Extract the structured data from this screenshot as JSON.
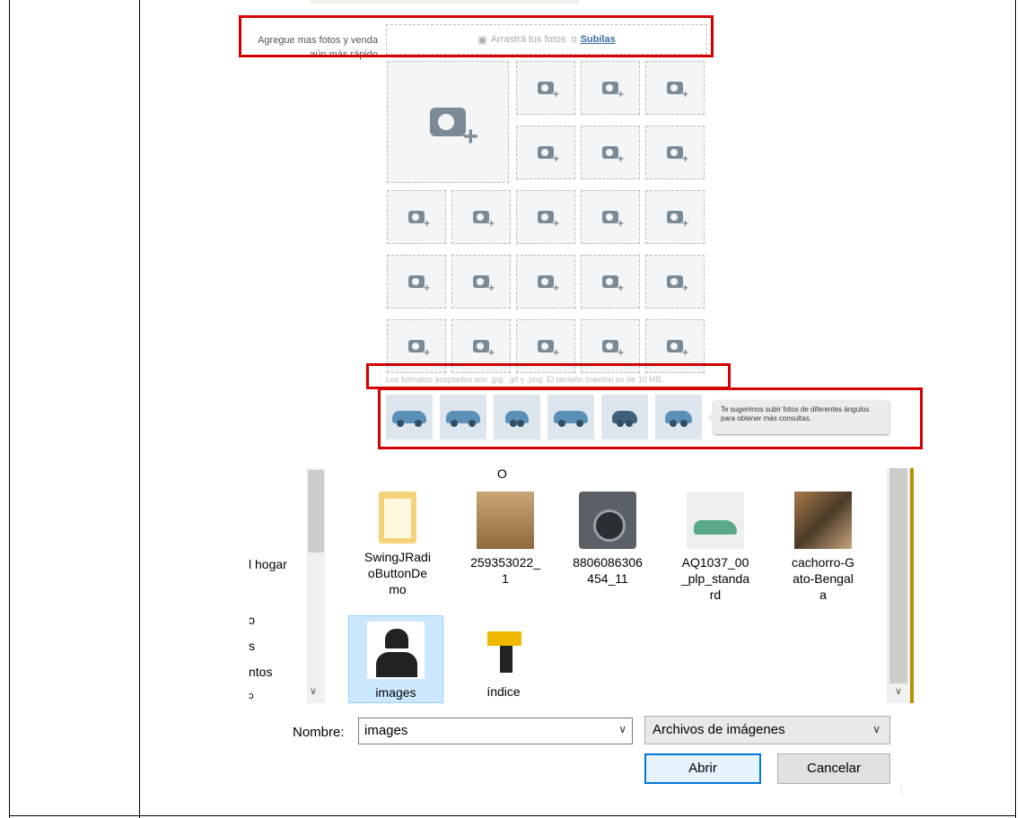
{
  "upload": {
    "prompt": "Agregue mas fotos y venda aún más rápido",
    "drop_text": "Arrastrá tus fotos",
    "or_text": "o",
    "upload_link": "Subilas",
    "formats_note": "Los formatos aceptados son .jpg, .gif y .png. El tamaño máximo es de 10 MB.",
    "tip": "Te sugerimos subir fotos de diferentes ángulos para obtener más consultas.",
    "slot_icon": "camera-plus-icon",
    "car_angles": [
      "car-side-left-icon",
      "car-three-quarter-front-icon",
      "car-front-icon",
      "car-three-quarter-rear-icon",
      "car-rear-icon",
      "car-interior-icon"
    ]
  },
  "dialog": {
    "nav": {
      "items": [
        "l hogar",
        "ɔ",
        "s",
        "ntos",
        "ɔ"
      ]
    },
    "top_partial": "O",
    "files": [
      {
        "name": "SwingJRadi\noButtonDe\nmo",
        "icon": "folder-icon"
      },
      {
        "name": "259353022_\n1",
        "icon": "crib-photo"
      },
      {
        "name": "8806086306\n454_11",
        "icon": "washing-machine-photo"
      },
      {
        "name": "AQ1037_00\n_plp_standa\nrd",
        "icon": "sneaker-photo"
      },
      {
        "name": "cachorro-G\nato-Bengal\na",
        "icon": "cat-photo"
      },
      {
        "name": "images",
        "icon": "police-avatar"
      },
      {
        "name": "índice",
        "icon": "drill-photo"
      }
    ],
    "name_label": "Nombre:",
    "name_value": "images",
    "file_type": "Archivos de imágenes",
    "open_button": "Abrir",
    "cancel_button": "Cancelar"
  },
  "colors": {
    "highlight": "#d40000",
    "link": "#3a6ea5",
    "selection": "#cce8ff",
    "primary_border": "#0078d7"
  }
}
